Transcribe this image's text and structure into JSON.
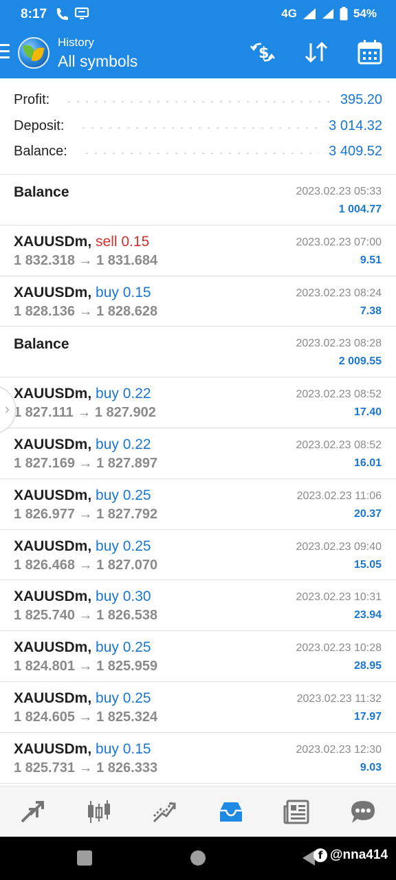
{
  "status_bar": {
    "time": "8:17",
    "network": "4G",
    "battery": "54%"
  },
  "header": {
    "subtitle": "History",
    "title": "All symbols",
    "actions": [
      "currency-exchange-icon",
      "sort-icon",
      "calendar-icon"
    ]
  },
  "summary": {
    "profit_label": "Profit:",
    "profit_value": "395.20",
    "deposit_label": "Deposit:",
    "deposit_value": "3 014.32",
    "balance_label": "Balance:",
    "balance_value": "3 409.52"
  },
  "deals": [
    {
      "title": "Balance",
      "date": "2023.02.23 05:33",
      "profit": "1 004.77"
    },
    {
      "symbol": "XAUUSDm,",
      "side": "sell",
      "volume": "sell 0.15",
      "prices": "1 832.318 → 1 831.684",
      "date": "2023.02.23 07:00",
      "profit": "9.51"
    },
    {
      "symbol": "XAUUSDm,",
      "side": "buy",
      "volume": "buy 0.15",
      "prices": "1 828.136 → 1 828.628",
      "date": "2023.02.23 08:24",
      "profit": "7.38"
    },
    {
      "title": "Balance",
      "date": "2023.02.23 08:28",
      "profit": "2 009.55"
    },
    {
      "symbol": "XAUUSDm,",
      "side": "buy",
      "volume": "buy 0.22",
      "prices": "1 827.111 → 1 827.902",
      "date": "2023.02.23 08:52",
      "profit": "17.40"
    },
    {
      "symbol": "XAUUSDm,",
      "side": "buy",
      "volume": "buy 0.22",
      "prices": "1 827.169 → 1 827.897",
      "date": "2023.02.23 08:52",
      "profit": "16.01"
    },
    {
      "symbol": "XAUUSDm,",
      "side": "buy",
      "volume": "buy 0.25",
      "prices": "1 826.977 → 1 827.792",
      "date": "2023.02.23 11:06",
      "profit": "20.37"
    },
    {
      "symbol": "XAUUSDm,",
      "side": "buy",
      "volume": "buy 0.25",
      "prices": "1 826.468 → 1 827.070",
      "date": "2023.02.23 09:40",
      "profit": "15.05"
    },
    {
      "symbol": "XAUUSDm,",
      "side": "buy",
      "volume": "buy 0.30",
      "prices": "1 825.740 → 1 826.538",
      "date": "2023.02.23 10:31",
      "profit": "23.94"
    },
    {
      "symbol": "XAUUSDm,",
      "side": "buy",
      "volume": "buy 0.25",
      "prices": "1 824.801 → 1 825.959",
      "date": "2023.02.23 10:28",
      "profit": "28.95"
    },
    {
      "symbol": "XAUUSDm,",
      "side": "buy",
      "volume": "buy 0.25",
      "prices": "1 824.605 → 1 825.324",
      "date": "2023.02.23 11:32",
      "profit": "17.97"
    },
    {
      "symbol": "XAUUSDm,",
      "side": "buy",
      "volume": "buy 0.15",
      "prices": "1 825.731 → 1 826.333",
      "date": "2023.02.23 12:30",
      "profit": "9.03"
    }
  ],
  "bottom_nav": [
    "quotes-icon",
    "chart-icon",
    "trade-icon",
    "history-icon",
    "news-icon",
    "chat-icon"
  ],
  "bottom_nav_active": "history-icon",
  "colors": {
    "accent": "#1e88e5",
    "profit_blue": "#1976d2",
    "sell_red": "#d32f2f",
    "muted_gray": "#8a8a8a"
  },
  "watermark": "@nna414"
}
